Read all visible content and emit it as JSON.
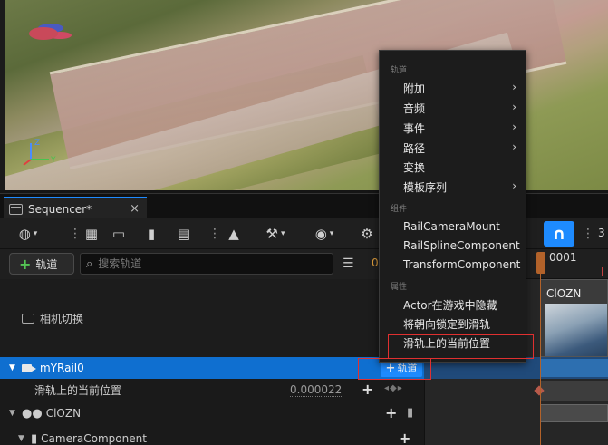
{
  "viewport": {
    "axis": {
      "x_label": "Y",
      "z_label": "Z"
    }
  },
  "sequencer": {
    "tab_title": "Sequencer*",
    "tab_close": "×",
    "toolbar": {
      "right_number": "3"
    },
    "add_track_button": "轨道",
    "search_placeholder": "搜索轨道",
    "current_frame_short": "0",
    "timeline": {
      "frame_label": "0001"
    },
    "tree": {
      "camera_cut_label": "相机切换",
      "rows": [
        {
          "label": "mYRail0",
          "action_label": "轨道",
          "selected": true
        },
        {
          "label": "滑轨上的当前位置",
          "value": "0.000022"
        },
        {
          "label": "ClOZN"
        },
        {
          "label": "CameraComponent"
        }
      ]
    },
    "clip": {
      "label": "ClOZN"
    }
  },
  "context_menu": {
    "sections": [
      {
        "header": "轨道",
        "items": [
          {
            "label": "附加",
            "submenu": true
          },
          {
            "label": "音频",
            "submenu": true
          },
          {
            "label": "事件",
            "submenu": true
          },
          {
            "label": "路径",
            "submenu": true
          },
          {
            "label": "变换",
            "submenu": false
          },
          {
            "label": "模板序列",
            "submenu": true
          }
        ]
      },
      {
        "header": "组件",
        "items": [
          {
            "label": "RailCameraMount"
          },
          {
            "label": "RailSplineComponent"
          },
          {
            "label": "TransformComponent"
          }
        ]
      },
      {
        "header": "属性",
        "items": [
          {
            "label": "Actor在游戏中隐藏"
          },
          {
            "label": "将朝向锁定到滑轨"
          },
          {
            "label": "滑轨上的当前位置"
          }
        ]
      }
    ]
  },
  "colors": {
    "accent": "#1e8bff",
    "selection": "#0f6fd0",
    "highlight_box": "#e03030",
    "playhead": "#b2622a",
    "add_green": "#54c354"
  },
  "icons": [
    "globe-icon",
    "gear-icon",
    "camera-icon",
    "clapper-icon",
    "wrench-icon",
    "eye-icon",
    "magnet-icon",
    "search-icon",
    "filter-icon",
    "plus-icon",
    "rail-actor-icon",
    "group-icon",
    "chevron-right-icon"
  ]
}
